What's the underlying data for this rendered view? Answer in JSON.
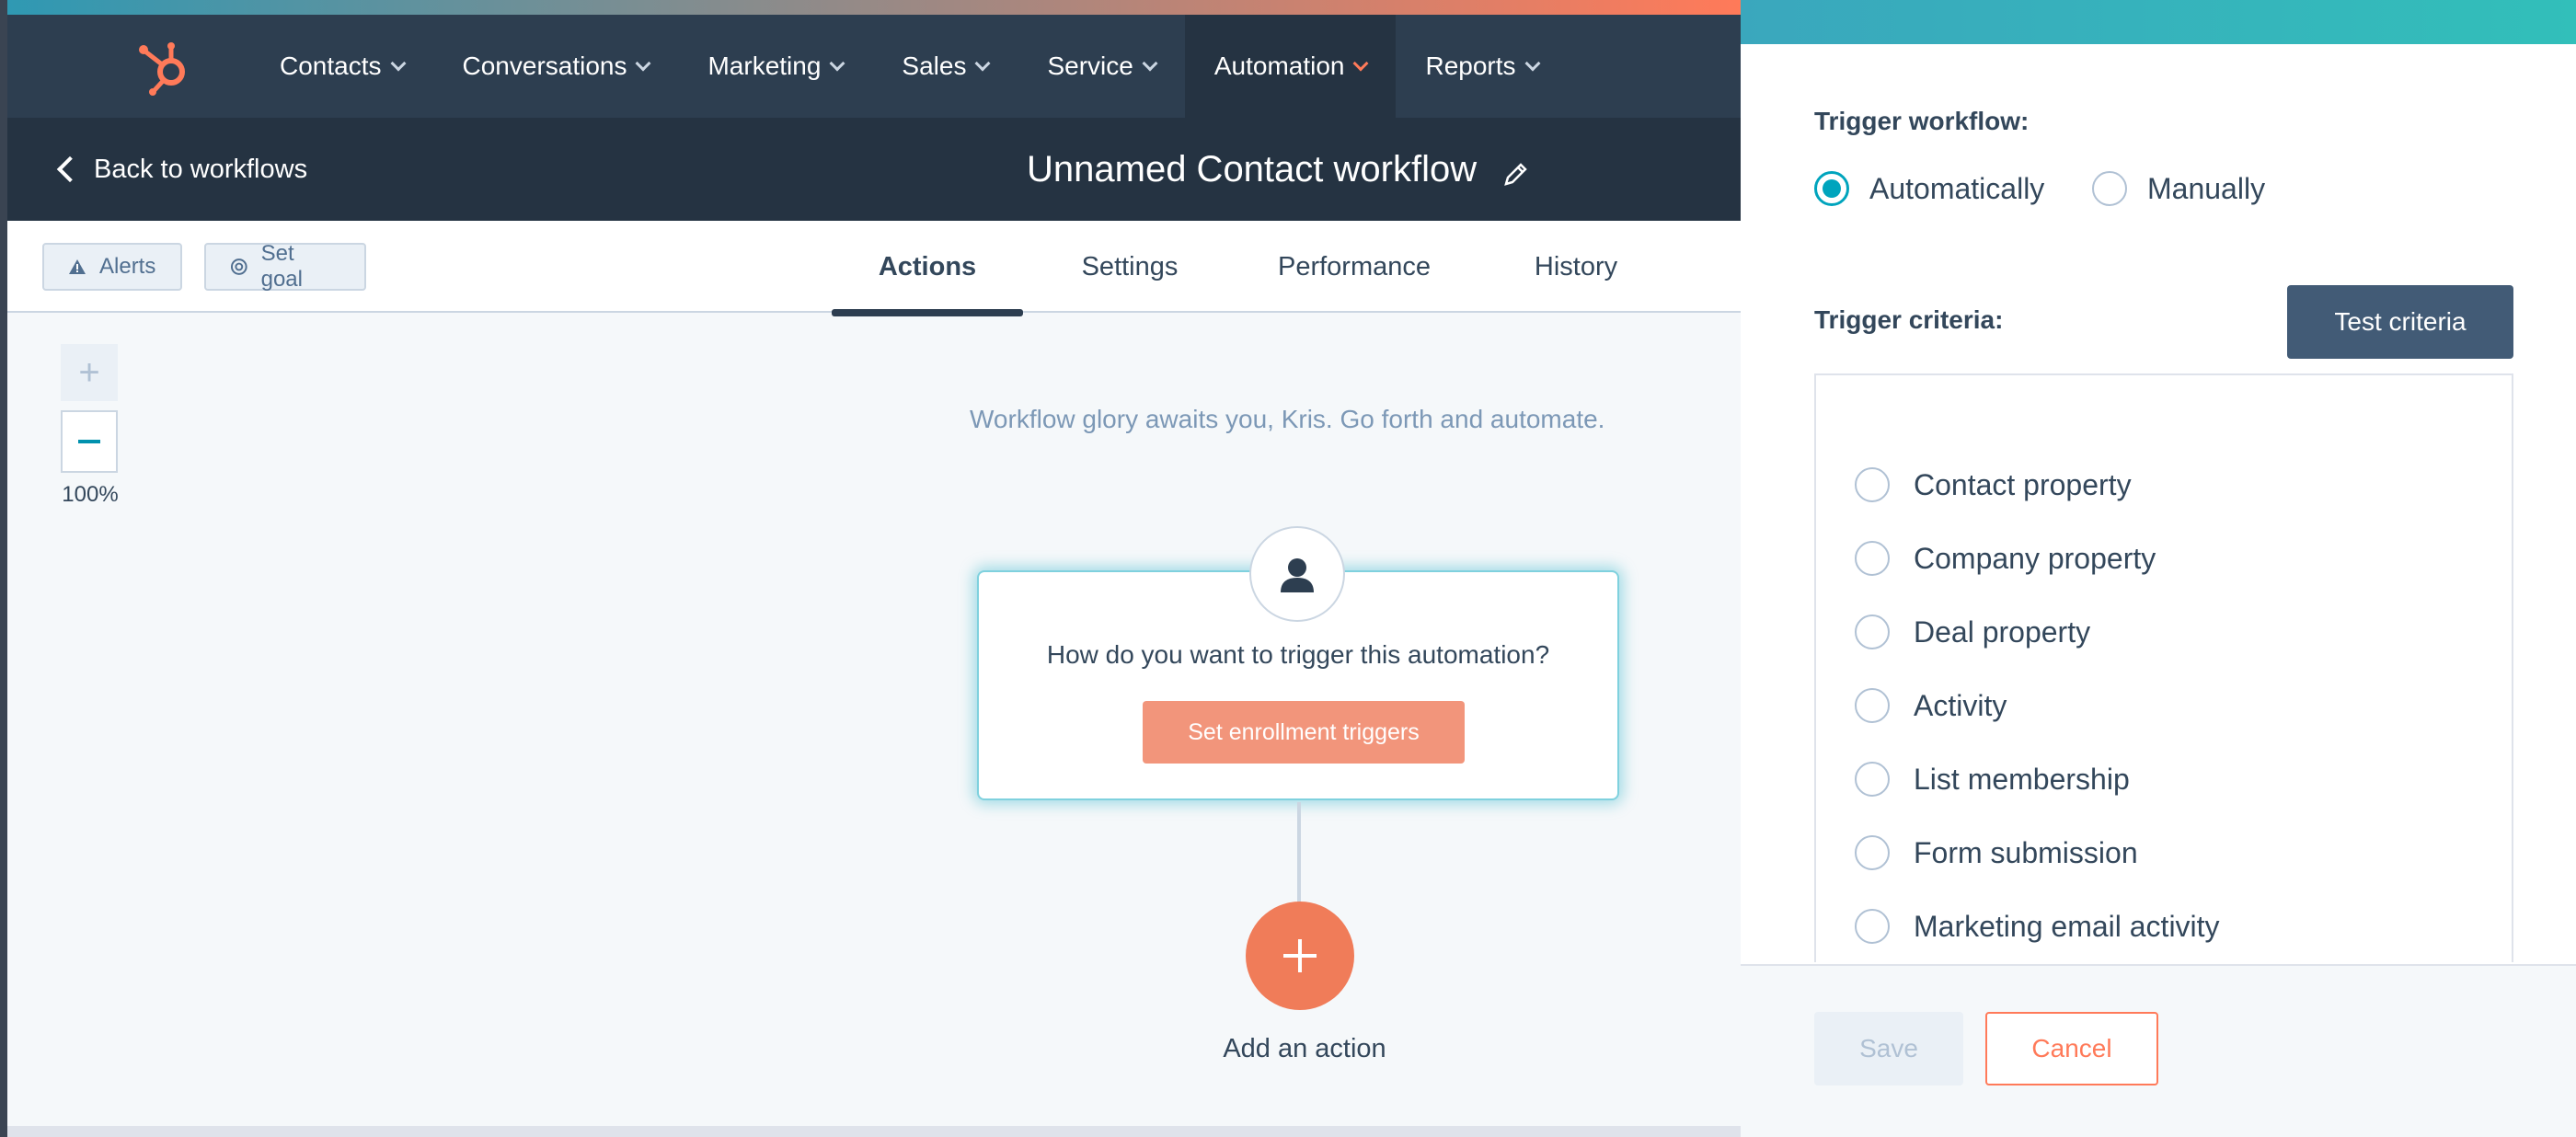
{
  "nav": {
    "items": [
      {
        "label": "Contacts"
      },
      {
        "label": "Conversations"
      },
      {
        "label": "Marketing"
      },
      {
        "label": "Sales"
      },
      {
        "label": "Service"
      },
      {
        "label": "Automation",
        "active": true
      },
      {
        "label": "Reports"
      }
    ]
  },
  "subheader": {
    "back_label": "Back to workflows",
    "workflow_title": "Unnamed Contact workflow"
  },
  "toolbar": {
    "alerts_label": "Alerts",
    "set_goal_label": "Set goal",
    "tabs": [
      {
        "label": "Actions",
        "active": true
      },
      {
        "label": "Settings"
      },
      {
        "label": "Performance"
      },
      {
        "label": "History"
      }
    ]
  },
  "canvas": {
    "zoom_level": "100%",
    "glory_message": "Workflow glory awaits you, Kris. Go forth and automate.",
    "trigger_question": "How do you want to trigger this automation?",
    "enroll_button": "Set enrollment triggers",
    "add_action_label": "Add an action"
  },
  "panel": {
    "trigger_workflow_label": "Trigger workflow:",
    "trigger_options": [
      {
        "label": "Automatically",
        "checked": true
      },
      {
        "label": "Manually",
        "checked": false
      }
    ],
    "trigger_criteria_label": "Trigger criteria:",
    "test_criteria_button": "Test criteria",
    "criteria": [
      {
        "label": "Contact property"
      },
      {
        "label": "Company property"
      },
      {
        "label": "Deal property"
      },
      {
        "label": "Activity"
      },
      {
        "label": "List membership"
      },
      {
        "label": "Form submission"
      },
      {
        "label": "Marketing email activity"
      }
    ],
    "save_button": "Save",
    "cancel_button": "Cancel"
  },
  "colors": {
    "accent_orange": "#ff7a59",
    "nav_dark": "#2d3e50",
    "teal": "#00a4bd"
  }
}
